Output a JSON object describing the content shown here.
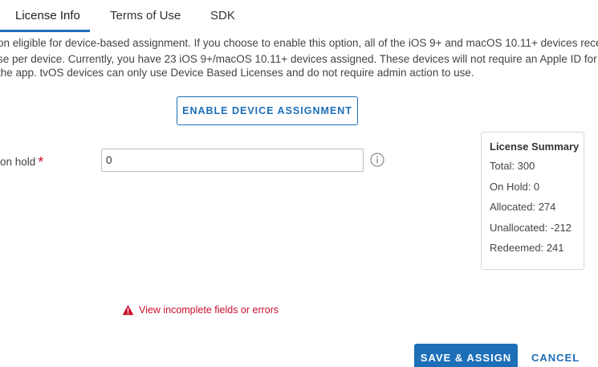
{
  "tabs": [
    {
      "label": "License Info",
      "active": true
    },
    {
      "label": "Terms of Use",
      "active": false
    },
    {
      "label": "SDK",
      "active": false
    }
  ],
  "description": {
    "line1": "on eligible for device-based assignment. If you choose to enable this option, all of the iOS 9+ and macOS 10.11+ devices rece",
    "line2": "se per device. Currently, you have 23 iOS 9+/macOS 10.11+ devices assigned. These devices will not require an Apple ID for",
    "line3": "the app. tvOS devices can only use Device Based Licenses and do not require admin action to use."
  },
  "enable_button_label": "ENABLE DEVICE ASSIGNMENT",
  "on_hold_field": {
    "label": "on hold",
    "required_marker": "*",
    "value": "0"
  },
  "license_summary": {
    "title": "License Summary",
    "rows": [
      "Total: 300",
      "On Hold: 0",
      "Allocated: 274",
      "Unallocated: -212",
      "Redeemed: 241"
    ]
  },
  "error_message": "View incomplete fields or errors",
  "footer": {
    "save_label": "SAVE & ASSIGN",
    "cancel_label": "CANCEL"
  },
  "colors": {
    "accent": "#1d6fb8",
    "error": "#c8102e"
  },
  "icons": {
    "info": "info-circle-icon",
    "warning": "warning-triangle-icon"
  }
}
